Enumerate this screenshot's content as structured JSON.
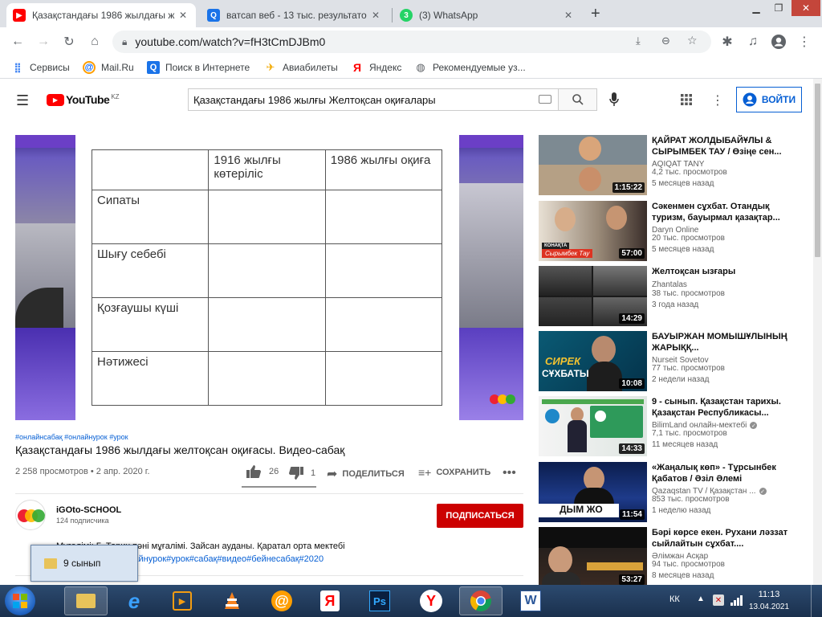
{
  "browser": {
    "tabs": [
      {
        "title": "Қазақстандағы 1986 жылдағы ж",
        "active": true
      },
      {
        "title": "ватсап веб - 13 тыс. результато",
        "active": false
      },
      {
        "title": "(3) WhatsApp",
        "active": false
      }
    ],
    "new_tab": "+",
    "url": "youtube.com/watch?v=fH3tCmDJBm0",
    "bookmarks": [
      "Сервисы",
      "Mail.Ru",
      "Поиск в Интернете",
      "Авиабилеты",
      "Яндекс",
      "Рекомендуемые уз..."
    ]
  },
  "youtube": {
    "logo": "YouTube",
    "region": "KZ",
    "search_value": "Қазақстандағы 1986 жылғы Желтоқсан оқиғалары",
    "signin_label": "ВОЙТИ"
  },
  "video": {
    "lesson_table": {
      "col1": "1916 жылғы көтеріліс",
      "col2": "1986 жылғы оқиға",
      "rows": [
        "Сипаты",
        "Шығу себебі",
        "Қозғаушы күші",
        "Нәтижесі"
      ]
    },
    "hashtags": "#онлайнсабақ #онлайнурок #урок",
    "title": "Қазақстандағы 1986 жылдағы желтоқсан оқиғасы. Видео-сабақ",
    "meta": "2 258 просмотров • 2 апр. 2020 г.",
    "likes": "26",
    "dislikes": "1",
    "share_label": "ПОДЕЛИТЬСЯ",
    "save_label": "СОХРАНИТЬ",
    "channel_name": "iGOto-SCHOOL",
    "subscribers": "124 подписчика",
    "subscribe_label": "ПОДПИСАТЬСЯ",
    "description_line1": "Мұғалімі: Ғ. Тарих пәні мұғалімі. Зайсан ауданы. Қаратал орта мектебі",
    "description_line2": "#онлайнсабақ#онлайнурок#урок#сабақ#видео#бейнесабақ#2020"
  },
  "related": [
    {
      "title": "ҚАЙРАТ ЖОЛДЫБАЙҰЛЫ & СЫРЫМБЕК ТАУ / Өзіңе сен...",
      "channel": "AQIQAT TANY",
      "views": "4,2 тыс. просмотров",
      "date": "5 месяцев назад",
      "duration": "1:15:22"
    },
    {
      "title": "Сәкенмен сұхбат. Отандық туризм, бауырмал қазақтар...",
      "channel": "Daryn Online",
      "views": "20 тыс. просмотров",
      "date": "5 месяцев назад",
      "duration": "57:00"
    },
    {
      "title": "Желтоқсан ызғары",
      "channel": "Zhantalas",
      "views": "38 тыс. просмотров",
      "date": "3 года назад",
      "duration": "14:29"
    },
    {
      "title": "БАУЫРЖАН МОМЫШҰЛЫНЫҢ ЖАРЫҚҚ...",
      "channel": "Nurseit Sovetov",
      "views": "77 тыс. просмотров",
      "date": "2 недели назад",
      "duration": "10:08"
    },
    {
      "title": "9 - сынып. Қазақстан тарихы. Қазақстан Республикасы...",
      "channel": "BilimLand онлайн-мектебі",
      "views": "7,1 тыс. просмотров",
      "date": "11 месяцев назад",
      "duration": "14:33"
    },
    {
      "title": "«Жаңалық көп» - Тұрсынбек Қабатов / Әзіл Әлемі",
      "channel": "Qazaqstan TV / Қазақстан ...",
      "views": "853 тыс. просмотров",
      "date": "1 неделю назад",
      "duration": "11:54"
    },
    {
      "title": "Бәрі көрсе екен. Рухани ләззат сыйлайтын сұхбат....",
      "channel": "Әлімжан Асқар",
      "views": "94 тыс. просмотров",
      "date": "8 месяцев назад",
      "duration": "53:27"
    }
  ],
  "thumb_text": {
    "kzk": "КОНАҚТА",
    "guest": "Сырымбек Тау",
    "sirek1": "СИРЕК",
    "sirek2": "СҰХБАТЫ",
    "dym": "ДЫМ ЖО"
  },
  "taskbar": {
    "tooltip": "9 сынып",
    "lang": "КК",
    "time": "11:13",
    "date": "13.04.2021"
  }
}
